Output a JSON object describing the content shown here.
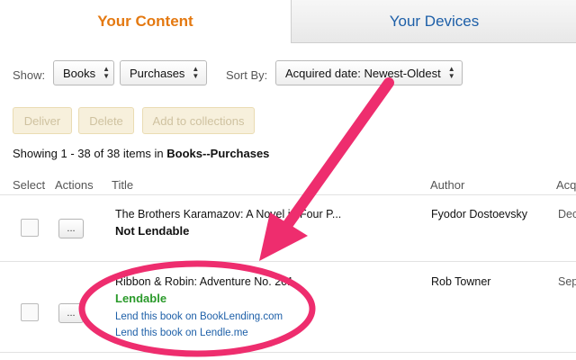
{
  "tabs": {
    "active": "Your Content",
    "inactive": "Your Devices"
  },
  "filters": {
    "show_label": "Show:",
    "type_value": "Books",
    "scope_value": "Purchases",
    "sort_label": "Sort By:",
    "sort_value": "Acquired date: Newest-Oldest"
  },
  "actions": {
    "deliver": "Deliver",
    "delete": "Delete",
    "add_to_collections": "Add to collections"
  },
  "summary": {
    "prefix": "Showing 1 - 38 of 38 items in ",
    "context": "Books--Purchases"
  },
  "table": {
    "columns": [
      "Select",
      "Actions",
      "Title",
      "Author",
      "Acq"
    ],
    "rows": [
      {
        "action_label": "...",
        "title": "The Brothers Karamazov: A Novel in Four P...",
        "status": "Not Lendable",
        "author": "Fyodor Dostoevsky",
        "acquired": "Dec"
      },
      {
        "action_label": "...",
        "title": "Ribbon & Robin: Adventure No. 201",
        "status": "Lendable",
        "link1": "Lend this book on BookLending.com",
        "link2": "Lend this book on Lendle.me",
        "author": "Rob Towner",
        "acquired": "Sep"
      }
    ]
  },
  "colors": {
    "active_tab": "#e47911",
    "link": "#1d5fa8",
    "lendable": "#2a9a2a",
    "annotation": "#ee2d6e"
  },
  "icons": {
    "select_chevron": "up-down-chevron-icon",
    "annotation": "arrow-and-circle-highlight"
  }
}
